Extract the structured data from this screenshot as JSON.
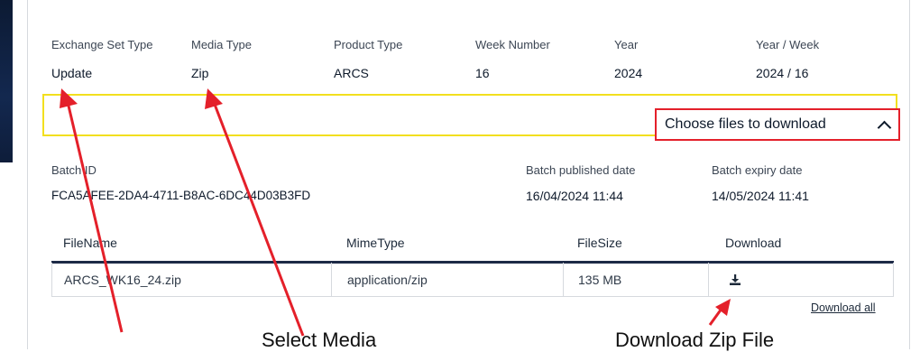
{
  "details": {
    "exchange_set_type": {
      "label": "Exchange Set Type",
      "value": "Update"
    },
    "media_type": {
      "label": "Media Type",
      "value": "Zip"
    },
    "product_type": {
      "label": "Product Type",
      "value": "ARCS"
    },
    "week_number": {
      "label": "Week Number",
      "value": "16"
    },
    "year": {
      "label": "Year",
      "value": "2024"
    },
    "year_week": {
      "label": "Year / Week",
      "value": "2024 / 16"
    }
  },
  "choose_files": {
    "label": "Choose files to download"
  },
  "batch": {
    "id_label": "Batch ID",
    "id_value": "FCA5AFEE-2DA4-4711-B8AC-6DC44D03B3FD",
    "published_label": "Batch published date",
    "published_value": "16/04/2024 11:44",
    "expiry_label": "Batch expiry date",
    "expiry_value": "14/05/2024 11:41"
  },
  "table": {
    "headers": [
      "FileName",
      "MimeType",
      "FileSize",
      "Download"
    ],
    "rows": [
      {
        "filename": "ARCS_WK16_24.zip",
        "mimetype": "application/zip",
        "filesize": "135 MB",
        "download_icon": "download-icon"
      }
    ]
  },
  "download_all": "Download all",
  "annotations": {
    "select_media": "Select Media",
    "download_zip": "Download Zip File",
    "arrow_color": "#e4202a",
    "highlight_color": "#f2df1e"
  }
}
